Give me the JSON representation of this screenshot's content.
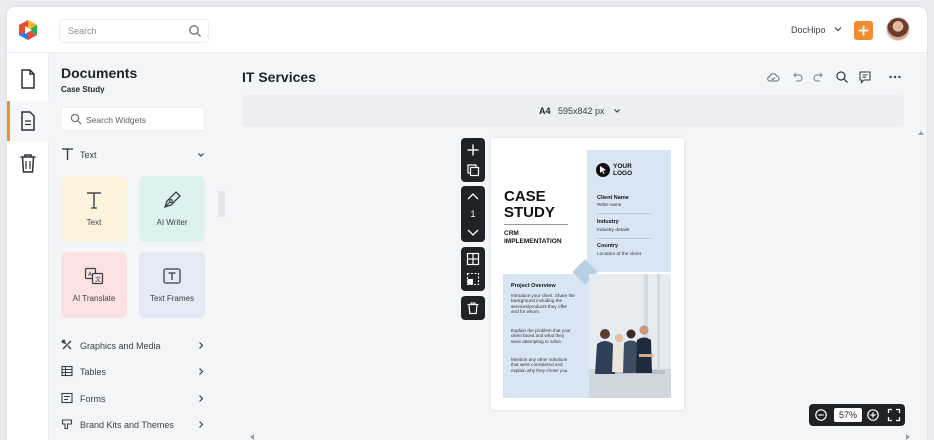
{
  "topbar": {
    "search_placeholder": "Search",
    "brand_name": "DocHipo",
    "colors": {
      "accent": "#f28b2e"
    }
  },
  "rail": {
    "items": [
      {
        "icon": "document-icon",
        "active": false
      },
      {
        "icon": "page-icon",
        "active": true
      },
      {
        "icon": "trash-icon",
        "active": false
      }
    ]
  },
  "panel": {
    "title": "Documents",
    "subtitle": "Case Study",
    "search_placeholder": "Search Widgets",
    "text_section": "Text",
    "tiles": [
      {
        "label": "Text",
        "icon": "text-icon"
      },
      {
        "label": "AI Writer",
        "icon": "pen-nib-icon"
      },
      {
        "label": "AI Translate",
        "icon": "translate-icon"
      },
      {
        "label": "Text Frames",
        "icon": "text-frame-icon"
      }
    ],
    "categories": [
      {
        "label": "Graphics and Media",
        "icon": "graphics-icon"
      },
      {
        "label": "Tables",
        "icon": "table-icon"
      },
      {
        "label": "Forms",
        "icon": "form-icon"
      },
      {
        "label": "Brand Kits and Themes",
        "icon": "brand-kit-icon"
      }
    ]
  },
  "main": {
    "title": "IT Services",
    "page_size": {
      "label": "A4",
      "dimensions": "595x842 px"
    },
    "page_number": "1",
    "zoom": "57%"
  },
  "document_page": {
    "logo_text": "YOUR\nLOGO",
    "heading": "CASE\nSTUDY",
    "subheading": "CRM\nIMPLEMENTATION",
    "fields": [
      {
        "label": "Client Name",
        "value": "Write name"
      },
      {
        "label": "Industry",
        "value": "Industry details"
      },
      {
        "label": "Country",
        "value": "Location of the client"
      }
    ],
    "overview_title": "Project Overview",
    "paragraphs": [
      "Introduce your client. Share the background including the services/products they offer and for whom.",
      "Explain the problem that your client faced and what they were attempting to solve.",
      "Mention any other solutions that were considered and explain why they chose you."
    ]
  }
}
